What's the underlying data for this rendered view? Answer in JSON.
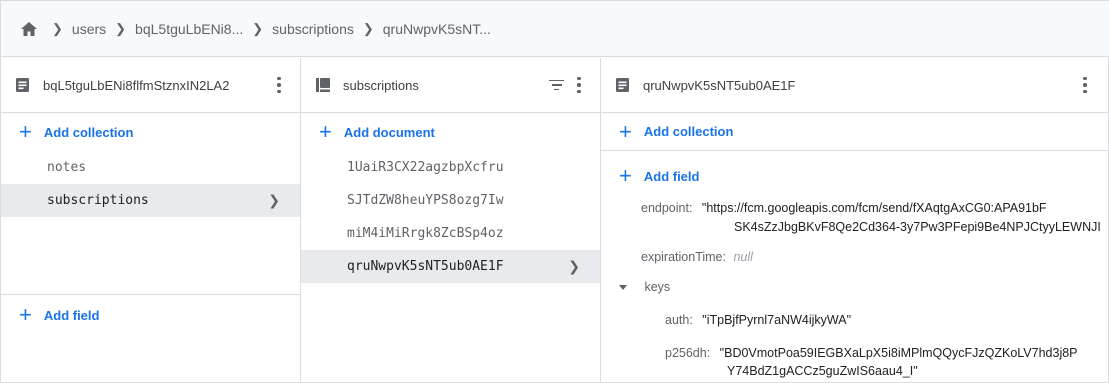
{
  "breadcrumb": {
    "items": [
      "users",
      "bqL5tguLbENi8...",
      "subscriptions",
      "qruNwpvK5sNT..."
    ]
  },
  "col_users": {
    "title": "bqL5tguLbENi8flfmStznxIN2LA2",
    "add_collection": "Add collection",
    "items": [
      "notes",
      "subscriptions"
    ],
    "add_field": "Add field"
  },
  "col_subscriptions": {
    "title": "subscriptions",
    "add_document": "Add document",
    "items": [
      "1UaiR3CX22agzbpXcfru",
      "SJTdZW8heuYPS8ozg7Iw",
      "miM4iMiRrgk8ZcBSp4oz",
      "qruNwpvK5sNT5ub0AE1F"
    ]
  },
  "col_document": {
    "title": "qruNwpvK5sNT5ub0AE1F",
    "add_collection": "Add collection",
    "add_field": "Add field",
    "fields": {
      "endpoint_key": "endpoint:",
      "endpoint_line1": "\"https://fcm.googleapis.com/fcm/send/fXAqtgAxCG0:APA91bF",
      "endpoint_line2": "SK4sZzJbgBKvF8Qe2Cd364-3y7Pw3PFepi9Be4NPJCtyyLEWNJI",
      "expiration_key": "expirationTime:",
      "expiration_val": "null",
      "keys_key": "keys",
      "auth_key": "auth:",
      "auth_val": "\"iTpBjfPyrnl7aNW4ijkyWA\"",
      "p256dh_key": "p256dh:",
      "p256dh_line1": "\"BD0VmotPoa59IEGBXaLpX5i8iMPlmQQycFJzQZKoLV7hd3j8P",
      "p256dh_line2": "Y74BdZ1gACCz5guZwIS6aau4_I\""
    }
  },
  "colors": {
    "accent": "#1a73e8",
    "selected_bg": "#e8eaed",
    "border": "#dadce0"
  }
}
